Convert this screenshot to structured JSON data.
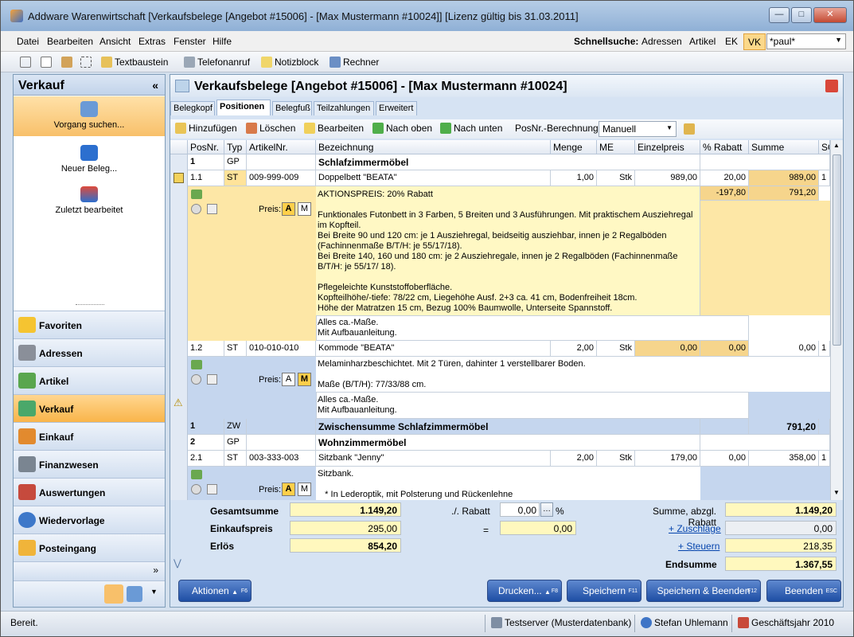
{
  "window": {
    "title": "Addware Warenwirtschaft [Verkaufsbelege [Angebot #15006] - [Max Mustermann #10024]]   [Lizenz gültig bis 31.03.2011]"
  },
  "menu": [
    "Datei",
    "Bearbeiten",
    "Ansicht",
    "Extras",
    "Fenster",
    "Hilfe"
  ],
  "quicksearch": {
    "label": "Schnellsuche:",
    "scopes": [
      "Adressen",
      "Artikel",
      "EK",
      "VK"
    ],
    "value": "*paul*"
  },
  "toolbar": {
    "textbaustein": "Textbaustein",
    "telefon": "Telefonanruf",
    "notiz": "Notizblock",
    "rechner": "Rechner"
  },
  "nav": {
    "title": "Verkauf",
    "collapse": "«",
    "tasks": [
      "Vorgang suchen...",
      "Neuer Beleg...",
      "Zuletzt bearbeitet"
    ],
    "sections": [
      "Favoriten",
      "Adressen",
      "Artikel",
      "Verkauf",
      "Einkauf",
      "Finanzwesen",
      "Auswertungen",
      "Wiedervorlage",
      "Posteingang"
    ]
  },
  "doc": {
    "title": "Verkaufsbelege [Angebot #15006] - [Max Mustermann #10024]",
    "tabs": [
      "Belegkopf",
      "Positionen",
      "Belegfuß",
      "Teilzahlungen",
      "Erweitert"
    ],
    "toolbar": {
      "add": "Hinzufügen",
      "del": "Löschen",
      "edit": "Bearbeiten",
      "up": "Nach oben",
      "down": "Nach unten",
      "posnr_label": "PosNr.-Berechnung",
      "posnr_value": "Manuell"
    }
  },
  "grid": {
    "headers": [
      "PosNr.",
      "Typ",
      "ArtikelNr.",
      "Bezeichnung",
      "Menge",
      "ME",
      "Einzelpreis",
      "% Rabatt",
      "Summe",
      "SO"
    ],
    "rows": [
      {
        "pos": "1",
        "typ": "GP",
        "art": "",
        "bez": "Schlafzimmermöbel"
      },
      {
        "pos": "1.1",
        "typ": "ST",
        "art": "009-999-009",
        "bez": "Doppelbett \"BEATA\"",
        "menge": "1,00",
        "me": "Stk",
        "ep": "989,00",
        "rab": "20,00",
        "sum": "989,00",
        "so": "1"
      },
      {
        "pos": "1.2",
        "typ": "ST",
        "art": "010-010-010",
        "bez": "Kommode \"BEATA\"",
        "menge": "2,00",
        "me": "Stk",
        "ep": "0,00",
        "rab": "0,00",
        "sum": "0,00",
        "so": "1"
      },
      {
        "pos": "1",
        "typ": "ZW",
        "art": "",
        "bez": "Zwischensumme Schlafzimmermöbel",
        "sum": "791,20"
      },
      {
        "pos": "2",
        "typ": "GP",
        "art": "",
        "bez": "Wohnzimmermöbel"
      },
      {
        "pos": "2.1",
        "typ": "ST",
        "art": "003-333-003",
        "bez": "Sitzbank \"Jenny\"",
        "menge": "2,00",
        "me": "Stk",
        "ep": "179,00",
        "rab": "0,00",
        "sum": "358,00",
        "so": "1"
      }
    ],
    "rabatt_line": {
      "rab": "-197,80",
      "sum": "791,20"
    },
    "preis_label": "Preis:",
    "preis_a": "A",
    "preis_m": "M",
    "text1": "AKTIONSPREIS: 20% Rabatt\n\nFunktionales Futonbett in 3 Farben, 5 Breiten und 3 Ausführungen. Mit praktischem Ausziehregal im Kopfteil.\nBei Breite 90 und 120 cm: je 1 Ausziehregal, beidseitig ausziehbar, innen je 2 Regalböden (Fachinnenmaße B/T/H: je 55/17/18).\nBei Breite 140, 160 und 180 cm: je 2 Ausziehregale, innen je 2 Regalböden (Fachinnenmaße B/T/H: je 55/17/ 18).\n\nPflegeleichte Kunststoffoberfläche.\nKopfteilhöhe/-tiefe: 78/22 cm, Liegehöhe Ausf. 2+3 ca. 41 cm, Bodenfreiheit 18cm.\nHöhe der Matratzen 15 cm, Bezug 100% Baumwolle, Unterseite Spannstoff.",
    "note1": "Alles ca.-Maße.\nMit Aufbauanleitung.",
    "text2": "Melaminharzbeschichtet. Mit 2 Türen, dahinter 1 verstellbarer Boden.\n\nMaße (B/T/H): 77/33/88 cm.",
    "note2": "Alles ca.-Maße.\nMit Aufbauanleitung.",
    "text3": "Sitzbank.\n\n   * In Lederoptik, mit Polsterung und Rückenlehne"
  },
  "summary": {
    "gesamt_label": "Gesamtsumme",
    "gesamt": "1.149,20",
    "ek_label": "Einkaufspreis",
    "ek": "295,00",
    "erloes_label": "Erlös",
    "erloes": "854,20",
    "rabatt_label": "./. Rabatt",
    "rabatt_pct": "0,00",
    "pct": "%",
    "eq": "=",
    "rabatt_val": "0,00",
    "abzgl_label": "Summe, abzgl. Rabatt",
    "abzgl": "1.149,20",
    "zuschlaege_label": "+ Zuschläge",
    "zuschlaege": "0,00",
    "steuern_label": "+ Steuern",
    "steuern": "218,35",
    "end_label": "Endsumme",
    "end": "1.367,55"
  },
  "actions": {
    "aktionen": "Aktionen",
    "aktionen_fk": "F6",
    "drucken": "Drucken...",
    "drucken_fk": "F8",
    "speichern": "Speichern",
    "speichern_fk": "F11",
    "speichern_beenden": "Speichern & Beenden",
    "speichern_beenden_fk": "F12",
    "beenden": "Beenden",
    "beenden_fk": "ESC"
  },
  "status": {
    "left": "Bereit.",
    "server": "Testserver (Musterdatenbank)",
    "user": "Stefan Uhlemann",
    "year": "Geschäftsjahr 2010"
  }
}
